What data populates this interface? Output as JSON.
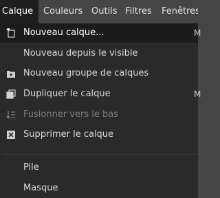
{
  "menubar": {
    "items": [
      "Calque",
      "Couleurs",
      "Outils",
      "Filtres",
      "Fenêtres"
    ]
  },
  "menu": {
    "items": [
      {
        "label": "Nouveau calque...",
        "icon": "new-layer-icon",
        "shortcut": "M"
      },
      {
        "label": "Nouveau depuis le visible",
        "icon": "",
        "shortcut": ""
      },
      {
        "label": "Nouveau groupe de calques",
        "icon": "layer-group-icon",
        "shortcut": ""
      },
      {
        "label": "Dupliquer le calque",
        "icon": "duplicate-icon",
        "shortcut": "M"
      },
      {
        "label": "Fusionner vers le bas",
        "icon": "merge-down-icon",
        "shortcut": "",
        "disabled": true
      },
      {
        "label": "Supprimer le calque",
        "icon": "delete-icon",
        "shortcut": ""
      },
      {
        "label": "Pile",
        "icon": "",
        "shortcut": ""
      },
      {
        "label": "Masque",
        "icon": "",
        "shortcut": ""
      }
    ]
  },
  "colors": {
    "menubar_bg": "#454545",
    "menu_bg": "#2a2a2a",
    "hover_bg": "#1c1c1c",
    "text": "#dadada",
    "disabled_text": "#7d7d7d"
  }
}
